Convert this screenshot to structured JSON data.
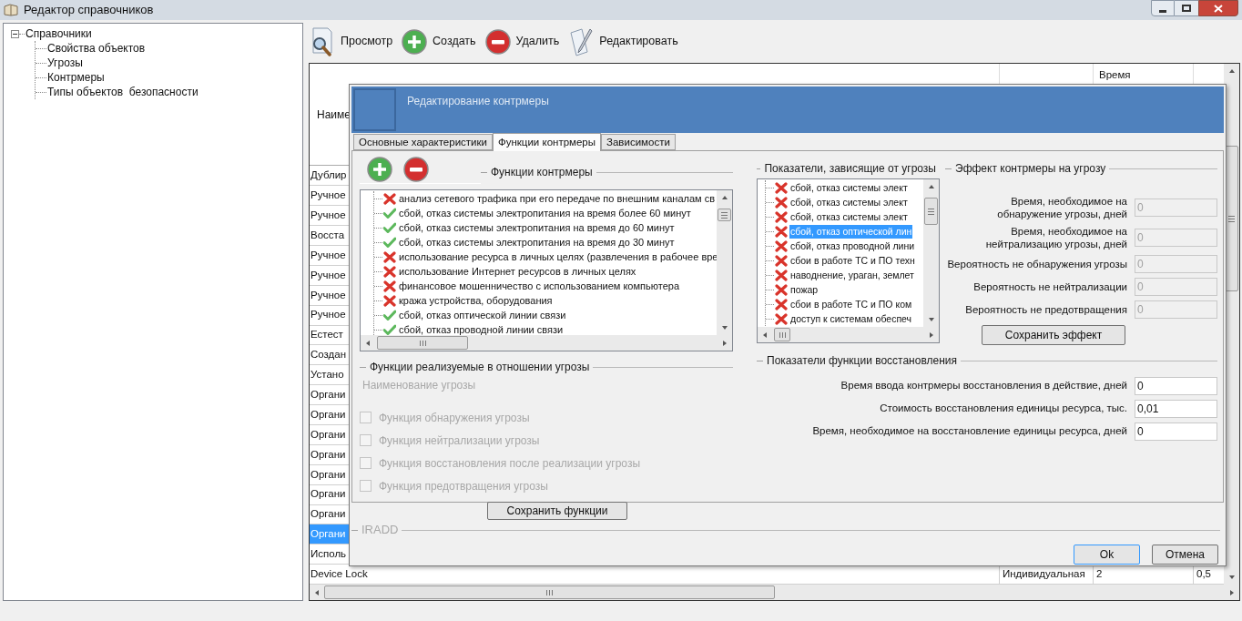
{
  "window": {
    "title": "Редактор справочников"
  },
  "sidebar": {
    "tree": [
      {
        "label": "Справочники",
        "expanded": true,
        "children": [
          {
            "label": "Свойства объектов"
          },
          {
            "label": "Угрозы"
          },
          {
            "label": "Контрмеры"
          },
          {
            "label": "Типы объектов  безопасности"
          }
        ]
      }
    ]
  },
  "toolbar": [
    {
      "kind": "view",
      "label": "Просмотр"
    },
    {
      "kind": "create",
      "label": "Создать"
    },
    {
      "kind": "delete",
      "label": "Удалить"
    },
    {
      "kind": "edit",
      "label": "Редактировать"
    }
  ],
  "grid": {
    "header": {
      "column_1": "Наиме",
      "column_3": "Время"
    },
    "rows": [
      {
        "cells": [
          "Дублир"
        ],
        "selected": false
      },
      {
        "cells": [
          "Ручное"
        ],
        "selected": false
      },
      {
        "cells": [
          "Ручное"
        ],
        "selected": false
      },
      {
        "cells": [
          "Восста"
        ],
        "selected": false
      },
      {
        "cells": [
          "Ручное"
        ],
        "selected": false
      },
      {
        "cells": [
          "Ручное"
        ],
        "selected": false
      },
      {
        "cells": [
          "Ручное"
        ],
        "selected": false
      },
      {
        "cells": [
          "Ручное"
        ],
        "selected": false
      },
      {
        "cells": [
          "Естест"
        ],
        "selected": false
      },
      {
        "cells": [
          "Создан"
        ],
        "selected": false
      },
      {
        "cells": [
          "Устано"
        ],
        "selected": false
      },
      {
        "cells": [
          "Органи"
        ],
        "selected": false
      },
      {
        "cells": [
          "Органи"
        ],
        "selected": false
      },
      {
        "cells": [
          "Органи"
        ],
        "selected": false
      },
      {
        "cells": [
          "Органи"
        ],
        "selected": false
      },
      {
        "cells": [
          "Органи"
        ],
        "selected": false
      },
      {
        "cells": [
          "Органи"
        ],
        "selected": false
      },
      {
        "cells": [
          "Органи"
        ],
        "selected": false
      },
      {
        "cells": [
          "Органи"
        ],
        "selected": true
      },
      {
        "cells": [
          "Исполь"
        ],
        "selected": false
      },
      {
        "cells": [
          "Device Lock",
          "Индивидуальная",
          "2",
          "0,5"
        ],
        "selected": false
      }
    ]
  },
  "dialog": {
    "title": "Редактирование контрмеры",
    "tabs": [
      {
        "label": "Основные характеристики",
        "selected": false
      },
      {
        "label": "Функции контрмеры",
        "selected": true
      },
      {
        "label": "Зависимости",
        "selected": false
      }
    ],
    "functions": {
      "title": "Функции контрмеры",
      "items": [
        {
          "label": "анализ сетевого трафика при его передаче по внешним каналам св",
          "checked": false
        },
        {
          "label": "сбой, отказ системы электропитания на время более 60 минут",
          "checked": true
        },
        {
          "label": "сбой, отказ системы электропитания на время до 60 минут",
          "checked": true
        },
        {
          "label": "сбой, отказ системы электропитания на время до 30 минут",
          "checked": true
        },
        {
          "label": "использование ресурса в личных целях (развлечения в рабочее вре",
          "checked": false
        },
        {
          "label": "использование Интернет ресурсов в личных целях",
          "checked": false
        },
        {
          "label": "финансовое мошенничество с использованием компьютера",
          "checked": false
        },
        {
          "label": "кража устройства, оборудования",
          "checked": false
        },
        {
          "label": "сбой, отказ оптической линии связи",
          "checked": true
        },
        {
          "label": "сбой, отказ проводной линии связи",
          "checked": true
        }
      ]
    },
    "threat_functions": {
      "title": "Функции реализуемые в отношении угрозы",
      "threat_name": "Наименование угрозы",
      "options": [
        {
          "label": "Функция обнаружения угрозы",
          "checked": false,
          "disabled": true
        },
        {
          "label": "Функция нейтрализации угрозы",
          "checked": false,
          "disabled": true
        },
        {
          "label": "Функция восстановления после реализации угрозы",
          "checked": false,
          "disabled": true
        },
        {
          "label": "Функция предотвращения угрозы",
          "checked": false,
          "disabled": true
        }
      ],
      "save_button": "Сохранить функции"
    },
    "threat_indicators": {
      "title": "Показатели, зависящие от угрозы",
      "items": [
        {
          "label": "сбой, отказ системы элект",
          "checked": false,
          "selected": false
        },
        {
          "label": "сбой, отказ системы элект",
          "checked": false,
          "selected": false
        },
        {
          "label": "сбой, отказ системы элект",
          "checked": false,
          "selected": false
        },
        {
          "label": "сбой, отказ оптической лин",
          "checked": false,
          "selected": true
        },
        {
          "label": "сбой, отказ проводной лини",
          "checked": false,
          "selected": false
        },
        {
          "label": "сбои в работе ТС и ПО техн",
          "checked": false,
          "selected": false
        },
        {
          "label": "наводнение, ураган, землет",
          "checked": false,
          "selected": false
        },
        {
          "label": "пожар",
          "checked": false,
          "selected": false
        },
        {
          "label": "сбои в работе ТС и ПО ком",
          "checked": false,
          "selected": false
        },
        {
          "label": "доступ к системам обеспеч",
          "checked": false,
          "selected": false
        }
      ]
    },
    "effect": {
      "title": "Эффект контрмеры на угрозу",
      "fields": [
        {
          "label": "Время, необходимое на обнаружение угрозы, дней",
          "value": "0",
          "disabled": true
        },
        {
          "label": "Время, необходимое на нейтрализацию угрозы, дней",
          "value": "0",
          "disabled": true
        },
        {
          "label": "Вероятность не обнаружения угрозы",
          "value": "0",
          "disabled": true
        },
        {
          "label": "Вероятность не нейтрализации",
          "value": "0",
          "disabled": true
        },
        {
          "label": "Вероятность не предотвращения",
          "value": "0",
          "disabled": true
        }
      ],
      "save_button": "Сохранить эффект"
    },
    "recovery": {
      "title": "Показатели функции восстановления",
      "fields": [
        {
          "label": "Время ввода контрмеры восстановления в действие, дней",
          "value": "0",
          "disabled": false
        },
        {
          "label": "Стоимость восстановления единицы ресурса, тыс.",
          "value": "0,01",
          "disabled": false
        },
        {
          "label": "Время, необходимое на восстановление единицы ресурса, дней",
          "value": "0",
          "disabled": false
        }
      ]
    },
    "iradd": {
      "title": "IRADD"
    },
    "buttons": [
      {
        "label": "Ok",
        "default": true
      },
      {
        "label": "Отмена",
        "default": false
      }
    ]
  }
}
